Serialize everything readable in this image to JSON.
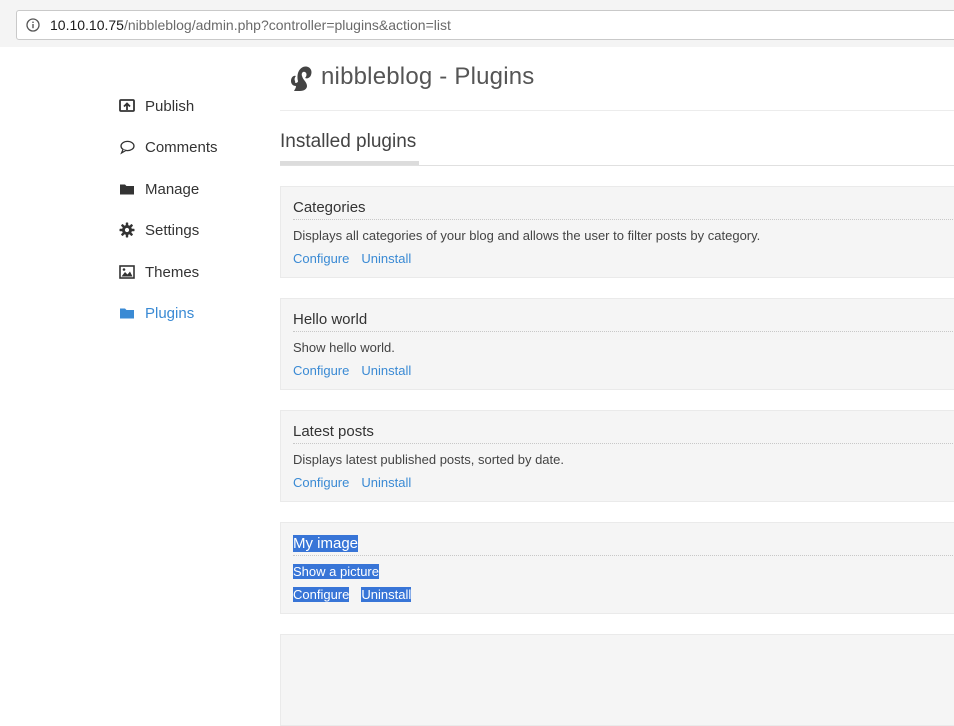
{
  "browser": {
    "url_host": "10.10.10.75",
    "url_path": "/nibbleblog/admin.php?controller=plugins&action=list"
  },
  "sidebar": {
    "items": [
      {
        "label": "Publish",
        "icon": "publish-icon"
      },
      {
        "label": "Comments",
        "icon": "comment-icon"
      },
      {
        "label": "Manage",
        "icon": "folder-icon"
      },
      {
        "label": "Settings",
        "icon": "gear-icon"
      },
      {
        "label": "Themes",
        "icon": "image-icon"
      },
      {
        "label": "Plugins",
        "icon": "folder-icon",
        "active": true
      }
    ]
  },
  "header": {
    "title": "nibbleblog - Plugins"
  },
  "section": {
    "title": "Installed plugins"
  },
  "plugins": [
    {
      "name": "Categories",
      "description": "Displays all categories of your blog and allows the user to filter posts by category.",
      "configure": "Configure",
      "uninstall": "Uninstall"
    },
    {
      "name": "Hello world",
      "description": "Show hello world.",
      "configure": "Configure",
      "uninstall": "Uninstall"
    },
    {
      "name": "Latest posts",
      "description": "Displays latest published posts, sorted by date.",
      "configure": "Configure",
      "uninstall": "Uninstall"
    },
    {
      "name": "My image",
      "description": "Show a picture",
      "configure": "Configure",
      "uninstall": "Uninstall",
      "selected": true
    }
  ],
  "colors": {
    "accent": "#3a8ad4",
    "selection": "#3875d7",
    "plugin_bg": "#f5f5f5"
  }
}
